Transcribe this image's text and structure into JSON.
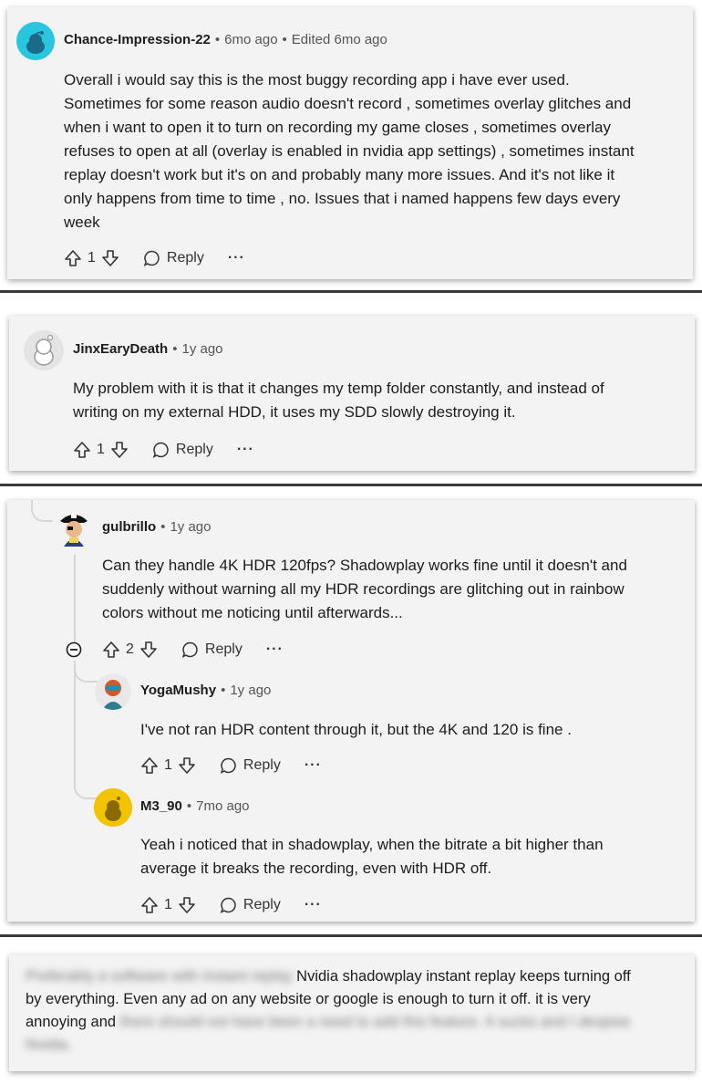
{
  "comments": [
    {
      "user": "Chance-Impression-22",
      "time": "6mo ago",
      "edited": "Edited 6mo ago",
      "lines": [
        "Overall i would say this is the most buggy recording app i have ever used.",
        "Sometimes for some reason audio doesn't record , sometimes overlay glitches and",
        "when i want to open it to turn on recording my game closes , sometimes overlay",
        "refuses to open at all (overlay is enabled in nvidia app settings) , sometimes instant",
        "replay doesn't work but it's on and probably many more issues. And it's not like it",
        "only happens from time to time , no. Issues that i named happens few days every",
        "week"
      ],
      "votes": "1",
      "reply": "Reply",
      "more": "···",
      "avatar_color": "#2ac6e0"
    },
    {
      "user": "JinxEaryDeath",
      "time": "1y ago",
      "lines": [
        "My problem with it is that it changes my temp folder constantly, and instead of",
        "writing on my external HDD, it uses my SDD slowly destroying it."
      ],
      "votes": "1",
      "reply": "Reply",
      "more": "···",
      "avatar_color": "#cfcfcf"
    },
    {
      "user": "gulbrillo",
      "time": "1y ago",
      "lines": [
        "Can they handle 4K HDR 120fps? Shadowplay works fine until it doesn't and",
        "suddenly without warning all my HDR recordings are glitching out in rainbow",
        "colors without me noticing until afterwards..."
      ],
      "votes": "2",
      "reply": "Reply",
      "more": "···",
      "avatar_color": "#1d2a55"
    },
    {
      "user": "YogaMushy",
      "time": "1y ago",
      "lines": [
        "I've not ran HDR content through it, but the 4K and 120 is fine ."
      ],
      "votes": "1",
      "reply": "Reply",
      "more": "···",
      "avatar_color": "#2e7d8c"
    },
    {
      "user": "M3_90",
      "time": "7mo ago",
      "lines": [
        "Yeah i noticed that in shadowplay, when the bitrate a bit higher than",
        "average it breaks the recording, even with HDR off."
      ],
      "votes": "1",
      "reply": "Reply",
      "more": "···",
      "avatar_color": "#f2c300"
    }
  ],
  "last": {
    "blur1": "Preferably a software with instant replay",
    "line1": "Nvidia shadowplay instant replay keeps turning off",
    "line2": "by everything. Even any ad on any website or google is enough to turn it off. it is very",
    "line3": "annoying and",
    "blur2": "there should not have been a need to add this feature. It sucks and I despise",
    "blur3": "Nvidia."
  },
  "colors": {
    "card_bg": "#f3f3f3",
    "separator": "#3a3a3a",
    "thread_line": "#d6d6d6"
  }
}
